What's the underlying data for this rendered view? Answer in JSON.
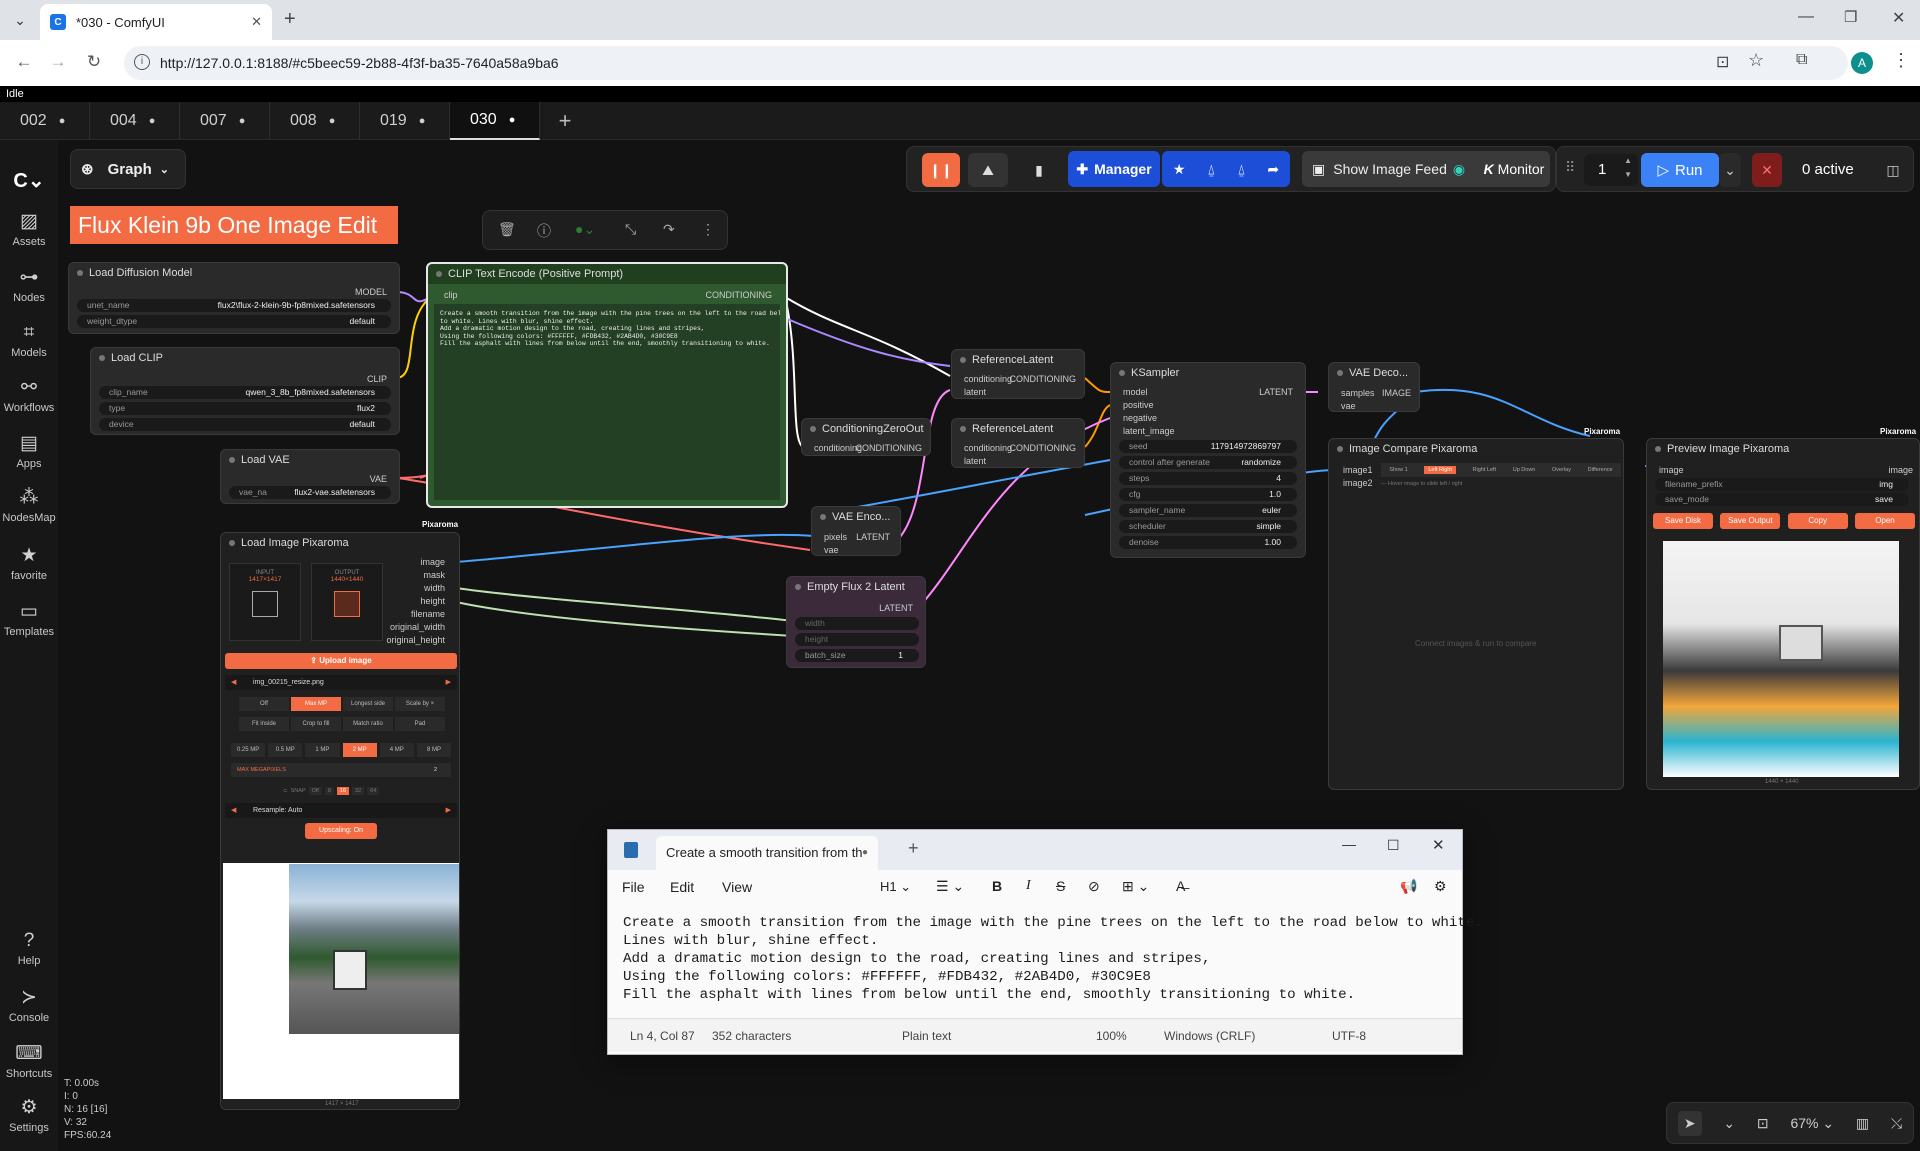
{
  "browser": {
    "tab_title": "*030 - ComfyUI",
    "url": "http://127.0.0.1:8188/#c5beec59-2b88-4f3f-ba35-7640a58a9ba6",
    "profile": "A"
  },
  "app": {
    "status": "Idle",
    "workflow_tabs": [
      {
        "label": "002"
      },
      {
        "label": "004"
      },
      {
        "label": "007"
      },
      {
        "label": "008"
      },
      {
        "label": "019"
      },
      {
        "label": "030"
      }
    ],
    "graph_label": "Graph",
    "sidebar": [
      "Assets",
      "Nodes",
      "Models",
      "Workflows",
      "Apps",
      "NodesMap",
      "favorite",
      "Templates",
      "Help",
      "Console",
      "Shortcuts",
      "Settings"
    ],
    "toolbar": {
      "manager": "Manager",
      "show_feed": "Show Image Feed",
      "monitor": "Monitor",
      "queue_count": "1",
      "run": "Run",
      "active": "0 active"
    },
    "workflow_title": "Flux Klein 9b One Image Edit",
    "stats": [
      "T: 0.00s",
      "I: 0",
      "N: 16 [16]",
      "V: 32",
      "FPS:60.24"
    ],
    "zoom": "67%"
  },
  "nodes": {
    "load_diffusion": {
      "title": "Load Diffusion Model",
      "out": "MODEL",
      "unet_name_label": "unet_name",
      "unet_name": "flux2\\flux-2-klein-9b-fp8mixed.safetensors",
      "weight_label": "weight_dtype",
      "weight": "default"
    },
    "load_clip": {
      "title": "Load CLIP",
      "out": "CLIP",
      "clip_name_label": "clip_name",
      "clip_name": "qwen_3_8b_fp8mixed.safetensors",
      "type_label": "type",
      "type": "flux2",
      "device_label": "device",
      "device": "default"
    },
    "load_vae": {
      "title": "Load VAE",
      "out": "VAE",
      "vae_label": "vae_na",
      "vae": "flux2-vae.safetensors"
    },
    "clip_text": {
      "title": "CLIP Text Encode (Positive Prompt)",
      "in": "clip",
      "out": "CONDITIONING",
      "text": "Create a smooth transition from the image with the pine trees on the left to the road below\nto white. Lines with blur, shine effect.\nAdd a dramatic motion design to the road, creating lines and stripes,\nUsing the following colors: #FFFFFF, #FDB432, #2AB4D0, #30C9E8\nFill the asphalt with lines from below until the end, smoothly transitioning to white."
    },
    "ref1": {
      "title": "ReferenceLatent",
      "in1": "conditioning",
      "out": "CONDITIONING",
      "in2": "latent"
    },
    "ref2": {
      "title": "ReferenceLatent",
      "in1": "conditioning",
      "out": "CONDITIONING",
      "in2": "latent"
    },
    "czero": {
      "title": "ConditioningZeroOut",
      "in": "conditioning",
      "out": "CONDITIONING"
    },
    "vae_enc": {
      "title": "VAE Enco...",
      "in1": "pixels",
      "in2": "vae",
      "out": "LATENT"
    },
    "empty_latent": {
      "title": "Empty Flux 2 Latent",
      "out": "LATENT",
      "w": "width",
      "h": "height",
      "batch_label": "batch_size",
      "batch": "1"
    },
    "ksampler": {
      "title": "KSampler",
      "inputs": [
        "model",
        "positive",
        "negative",
        "latent_image"
      ],
      "out": "LATENT",
      "widgets": [
        {
          "k": "seed",
          "v": "117914972869797"
        },
        {
          "k": "control after generate",
          "v": "randomize"
        },
        {
          "k": "steps",
          "v": "4"
        },
        {
          "k": "cfg",
          "v": "1.0"
        },
        {
          "k": "sampler_name",
          "v": "euler"
        },
        {
          "k": "scheduler",
          "v": "simple"
        },
        {
          "k": "denoise",
          "v": "1.00"
        }
      ]
    },
    "vae_dec": {
      "title": "VAE Deco...",
      "in1": "samples",
      "in2": "vae",
      "out": "IMAGE"
    },
    "compare": {
      "title": "Image Compare Pixaroma",
      "badge": "Pixaroma",
      "in1": "image1",
      "in2": "image2",
      "modes": [
        "Show 1",
        "Left Right",
        "Right Left",
        "Up Down",
        "Overlay",
        "Difference"
      ],
      "hint": "— Hover image to slide left / right",
      "empty": "Connect images & run to compare"
    },
    "preview": {
      "title": "Preview Image Pixaroma",
      "badge": "Pixaroma",
      "in": "image",
      "out": "image",
      "prefix_label": "filename_prefix",
      "prefix": "img",
      "mode_label": "save_mode",
      "mode": "save",
      "buttons": [
        "Save Disk",
        "Save Output",
        "Copy",
        "Open"
      ],
      "size": "1440 × 1440"
    },
    "load_image": {
      "title": "Load Image Pixaroma",
      "badge": "Pixaroma",
      "outputs": [
        "image",
        "mask",
        "width",
        "height",
        "filename",
        "original_width",
        "original_height"
      ],
      "input_label": "INPUT",
      "input_size": "1417×1417",
      "output_label": "OUTPUT",
      "output_size": "1440×1440",
      "upload": "Upload image",
      "file": "img_00215_resize.png",
      "fit": [
        "Off",
        "Max MP",
        "Longest side",
        "Scale by ×"
      ],
      "fit2": [
        "Fit inside",
        "Crop to fill",
        "Match ratio",
        "Pad"
      ],
      "mp": [
        "0.25 MP",
        "0.5 MP",
        "1 MP",
        "2 MP",
        "4 MP",
        "8 MP"
      ],
      "maxmp_label": "MAX MEGAPIXELS",
      "maxmp": "2",
      "snap_label": "SNAP",
      "snap": [
        "Off",
        "8",
        "16",
        "32",
        "64"
      ],
      "resample": "Resample: Auto",
      "upscale": "Upscaling: On",
      "size": "1417 × 1417"
    }
  },
  "notepad": {
    "tab": "Create a smooth transition from th",
    "menu": [
      "File",
      "Edit",
      "View"
    ],
    "heading": "H1",
    "text": "Create a smooth transition from the image with the pine trees on the left to the road below to white.\nLines with blur, shine effect.\nAdd a dramatic motion design to the road, creating lines and stripes,\nUsing the following colors: #FFFFFF, #FDB432, #2AB4D0, #30C9E8\nFill the asphalt with lines from below until the end, smoothly transitioning to white.",
    "status": {
      "pos": "Ln 4, Col 87",
      "chars": "352 characters",
      "fmt": "Plain text",
      "zoom": "100%",
      "eol": "Windows (CRLF)",
      "enc": "UTF-8"
    }
  },
  "colors": {
    "accent": "#f26b43",
    "run": "#3b82f6",
    "manager": "#1d4ed8",
    "clip_node": "#2f5a2f"
  }
}
